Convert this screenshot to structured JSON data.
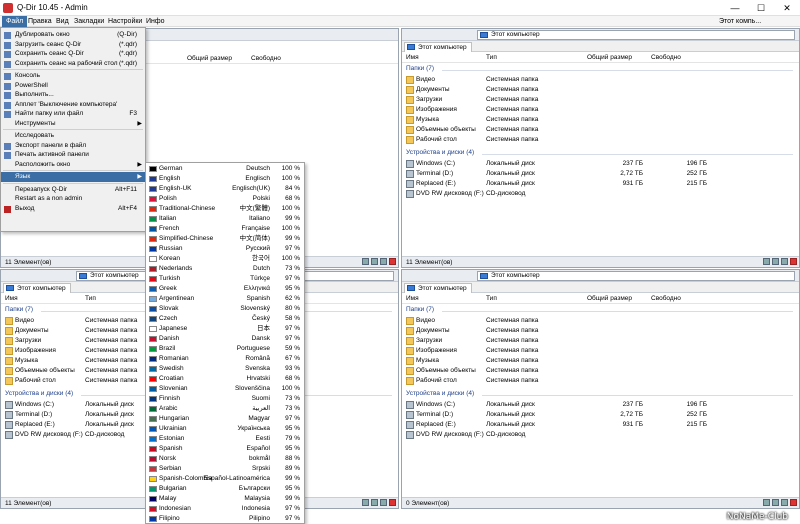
{
  "title": "Q-Dir 10.45 - Admin",
  "menubar": [
    "Файл",
    "Правка",
    "Вид",
    "Закладки",
    "Настройки",
    "Инфо"
  ],
  "toolbar_right": "Этот компь...",
  "address_label": "Этот компьютер",
  "tab_label": "Этот компьютер",
  "columns": {
    "name": "Имя",
    "type": "Тип",
    "total": "Общий размер",
    "free": "Свободно"
  },
  "group_folders": "Папки (7)",
  "group_drives": "Устройства и диски (4)",
  "folders": [
    {
      "name": "Видео",
      "type": "Системная папка"
    },
    {
      "name": "Документы",
      "type": "Системная папка"
    },
    {
      "name": "Загрузки",
      "type": "Системная папка"
    },
    {
      "name": "Изображения",
      "type": "Системная папка"
    },
    {
      "name": "Музыка",
      "type": "Системная папка"
    },
    {
      "name": "Объемные объекты",
      "type": "Системная папка"
    },
    {
      "name": "Рабочий стол",
      "type": "Системная папка"
    }
  ],
  "drives": [
    {
      "name": "Windows (C:)",
      "type": "Локальный диск",
      "total": "237 ГБ",
      "free": "196 ГБ"
    },
    {
      "name": "Terminal (D:)",
      "type": "Локальный диск",
      "total": "2,72 ТБ",
      "free": "252 ГБ"
    },
    {
      "name": "Replaced (E:)",
      "type": "Локальный диск",
      "total": "931 ГБ",
      "free": "215 ГБ"
    },
    {
      "name": "DVD RW дисковод (F:)",
      "type": "CD-дисковод",
      "total": "",
      "free": ""
    }
  ],
  "status_11": "11 Элемент(ов)",
  "status_0": "0 Элемент(ов)",
  "file_menu": [
    {
      "label": "Дублировать окно",
      "shortcut": "(Q-Dir)",
      "icon": "duplicate-icon"
    },
    {
      "label": "Загрузить сеанс Q-Dir",
      "shortcut": "(*.qdr)",
      "icon": "load-icon"
    },
    {
      "label": "Сохранить сеанс Q-Dir",
      "shortcut": "(*.qdr)",
      "icon": "save-icon"
    },
    {
      "label": "Сохранить сеанс на рабочий стол",
      "shortcut": "(*.qdr)",
      "icon": "desktop-icon"
    },
    {
      "sep": true
    },
    {
      "label": "Консоль",
      "shortcut": "",
      "icon": "console-icon"
    },
    {
      "label": "PowerShell",
      "shortcut": "",
      "icon": "powershell-icon"
    },
    {
      "label": "Выполнить...",
      "shortcut": "",
      "icon": "run-icon"
    },
    {
      "label": "Апплет 'Выключение компьютера'",
      "shortcut": "",
      "icon": "shutdown-icon"
    },
    {
      "label": "Найти папку или файл",
      "shortcut": "F3",
      "icon": "search-icon"
    },
    {
      "label": "Инструменты",
      "shortcut": "",
      "arrow": true,
      "icon": ""
    },
    {
      "sep": true
    },
    {
      "label": "Исследовать",
      "shortcut": "",
      "icon": ""
    },
    {
      "label": "Экспорт панели в файл",
      "shortcut": "",
      "icon": "export-icon"
    },
    {
      "label": "Печать активной панели",
      "shortcut": "",
      "icon": "print-icon"
    },
    {
      "label": "Расположить окно",
      "shortcut": "",
      "arrow": true,
      "icon": ""
    },
    {
      "sep": true
    },
    {
      "label": "Язык",
      "shortcut": "",
      "arrow": true,
      "icon": "",
      "highlight": true
    },
    {
      "sep": true
    },
    {
      "label": "Перезапуск Q-Dir",
      "shortcut": "Alt+F11",
      "icon": ""
    },
    {
      "label": "Restart as a non admin",
      "shortcut": "",
      "icon": ""
    },
    {
      "label": "Выход",
      "shortcut": "Alt+F4",
      "icon": "exit-icon"
    }
  ],
  "languages": [
    {
      "en": "German",
      "native": "Deutsch",
      "pct": "100 %",
      "flag": "#000000"
    },
    {
      "en": "English",
      "native": "Englisch",
      "pct": "100 %",
      "flag": "#1f3a93"
    },
    {
      "en": "English-UK",
      "native": "Englisch(UK)",
      "pct": "84 %",
      "flag": "#1f3a93"
    },
    {
      "en": "Polish",
      "native": "Polski",
      "pct": "68 %",
      "flag": "#dc143c"
    },
    {
      "en": "Traditional-Chinese",
      "native": "中文(繁體)",
      "pct": "100 %",
      "flag": "#de2910"
    },
    {
      "en": "Italian",
      "native": "Italiano",
      "pct": "99 %",
      "flag": "#009246"
    },
    {
      "en": "French",
      "native": "Française",
      "pct": "100 %",
      "flag": "#0055a4"
    },
    {
      "en": "Simplified-Chinese",
      "native": "中文(简体)",
      "pct": "99 %",
      "flag": "#de2910"
    },
    {
      "en": "Russian",
      "native": "Русский",
      "pct": "97 %",
      "flag": "#0039a6"
    },
    {
      "en": "Korean",
      "native": "한국어",
      "pct": "100 %",
      "flag": "#ffffff"
    },
    {
      "en": "Nederlands",
      "native": "Dutch",
      "pct": "73 %",
      "flag": "#ae1c28"
    },
    {
      "en": "Turkish",
      "native": "Türkçe",
      "pct": "97 %",
      "flag": "#e30a17"
    },
    {
      "en": "Greek",
      "native": "Ελληνικά",
      "pct": "95 %",
      "flag": "#0d5eaf"
    },
    {
      "en": "Argentinean",
      "native": "Spanish",
      "pct": "62 %",
      "flag": "#74acdf"
    },
    {
      "en": "Slovak",
      "native": "Slovenský",
      "pct": "80 %",
      "flag": "#0b4ea2"
    },
    {
      "en": "Czech",
      "native": "Český",
      "pct": "58 %",
      "flag": "#11457e"
    },
    {
      "en": "Japanese",
      "native": "日本",
      "pct": "97 %",
      "flag": "#ffffff"
    },
    {
      "en": "Danish",
      "native": "Dansk",
      "pct": "97 %",
      "flag": "#c8102e"
    },
    {
      "en": "Brazil",
      "native": "Portuguese",
      "pct": "59 %",
      "flag": "#009c3b"
    },
    {
      "en": "Romanian",
      "native": "Română",
      "pct": "67 %",
      "flag": "#002b7f"
    },
    {
      "en": "Swedish",
      "native": "Svenska",
      "pct": "93 %",
      "flag": "#006aa7"
    },
    {
      "en": "Croatian",
      "native": "Hrvatski",
      "pct": "68 %",
      "flag": "#ff0000"
    },
    {
      "en": "Slovenian",
      "native": "Slovenščina",
      "pct": "100 %",
      "flag": "#005da4"
    },
    {
      "en": "Finnish",
      "native": "Suomi",
      "pct": "73 %",
      "flag": "#003580"
    },
    {
      "en": "Arabic",
      "native": "العربية",
      "pct": "73 %",
      "flag": "#006c35"
    },
    {
      "en": "Hungarian",
      "native": "Magyar",
      "pct": "97 %",
      "flag": "#477050"
    },
    {
      "en": "Ukrainian",
      "native": "Українська",
      "pct": "95 %",
      "flag": "#0057b7"
    },
    {
      "en": "Estonian",
      "native": "Eesti",
      "pct": "79 %",
      "flag": "#0072ce"
    },
    {
      "en": "Spanish",
      "native": "Español",
      "pct": "95 %",
      "flag": "#c60b1e"
    },
    {
      "en": "Norsk",
      "native": "bokmål",
      "pct": "88 %",
      "flag": "#ba0c2f"
    },
    {
      "en": "Serbian",
      "native": "Srpski",
      "pct": "89 %",
      "flag": "#c6363c"
    },
    {
      "en": "Spanish-Colombia",
      "native": "Español-Latinoamérica",
      "pct": "99 %",
      "flag": "#fcd116"
    },
    {
      "en": "Bulgarian",
      "native": "Български",
      "pct": "95 %",
      "flag": "#00966e"
    },
    {
      "en": "Malay",
      "native": "Malaysia",
      "pct": "99 %",
      "flag": "#010066"
    },
    {
      "en": "Indonesian",
      "native": "Indonesia",
      "pct": "97 %",
      "flag": "#ce1126"
    },
    {
      "en": "Filipino",
      "native": "Pilipino",
      "pct": "97 %",
      "flag": "#0038a8"
    }
  ],
  "watermark": "NoNaMe-Club"
}
